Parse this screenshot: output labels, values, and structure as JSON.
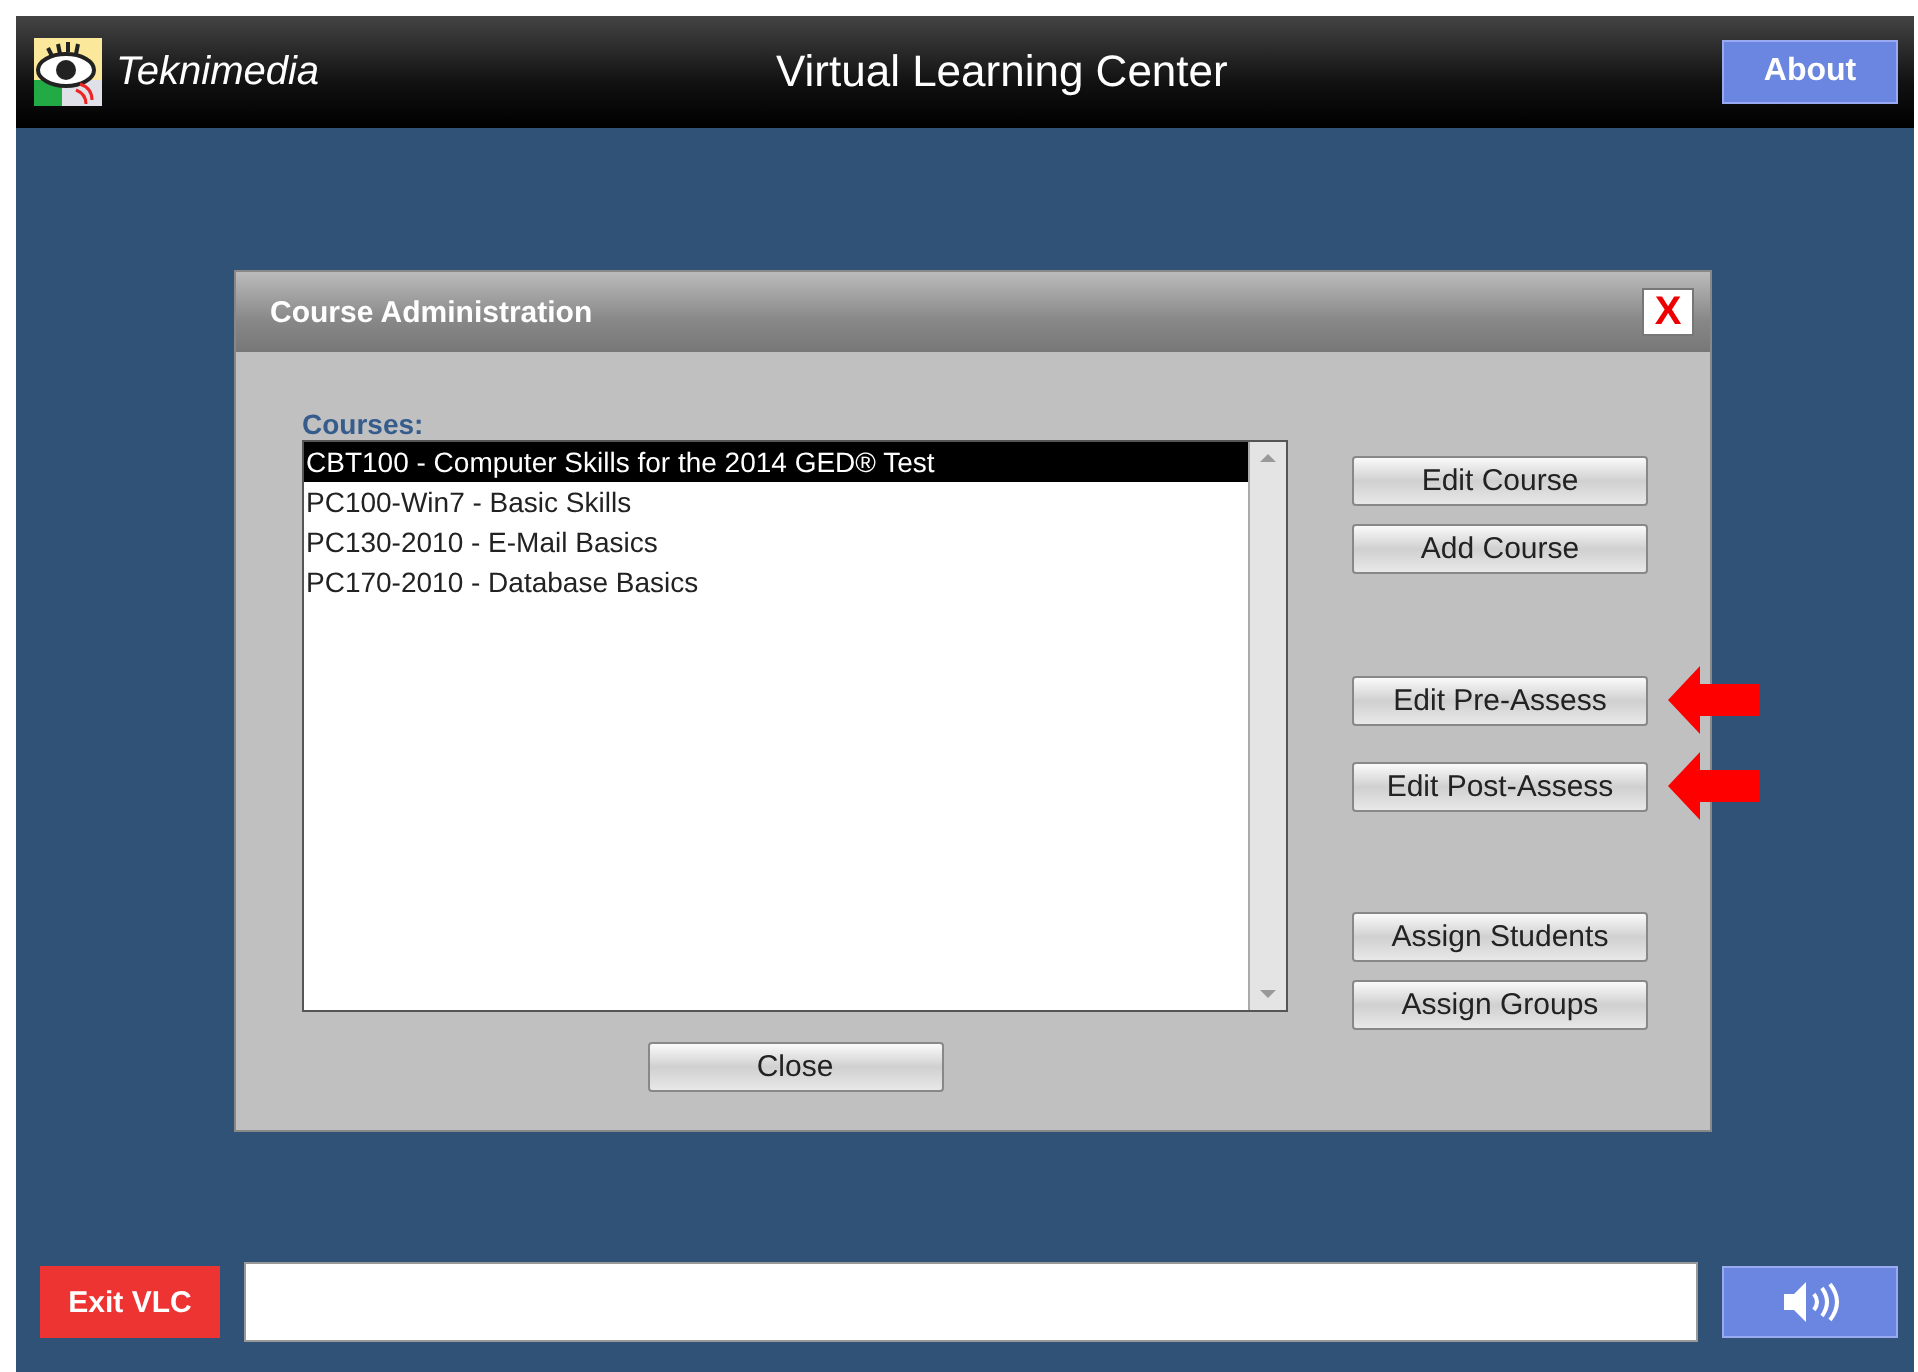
{
  "header": {
    "brand": "Teknimedia",
    "title": "Virtual Learning Center",
    "about_button": "About"
  },
  "dialog": {
    "title": "Course Administration",
    "close_icon": "X",
    "list_label": "Courses:",
    "courses": [
      {
        "label": "CBT100 - Computer Skills for the 2014 GED® Test",
        "selected": true
      },
      {
        "label": "PC100-Win7 - Basic Skills",
        "selected": false
      },
      {
        "label": "PC130-2010 - E-Mail Basics",
        "selected": false
      },
      {
        "label": "PC170-2010 - Database Basics",
        "selected": false
      }
    ],
    "action_groups": [
      [
        {
          "label": "Edit Course",
          "marked": false
        },
        {
          "label": "Add Course",
          "marked": false
        }
      ],
      [
        {
          "label": "Edit Pre-Assess",
          "marked": true
        },
        {
          "label": "Edit Post-Assess",
          "marked": true
        }
      ],
      [
        {
          "label": "Assign Students",
          "marked": false
        },
        {
          "label": "Assign Groups",
          "marked": false
        }
      ]
    ],
    "close_button": "Close"
  },
  "footer": {
    "exit_button": "Exit VLC"
  }
}
